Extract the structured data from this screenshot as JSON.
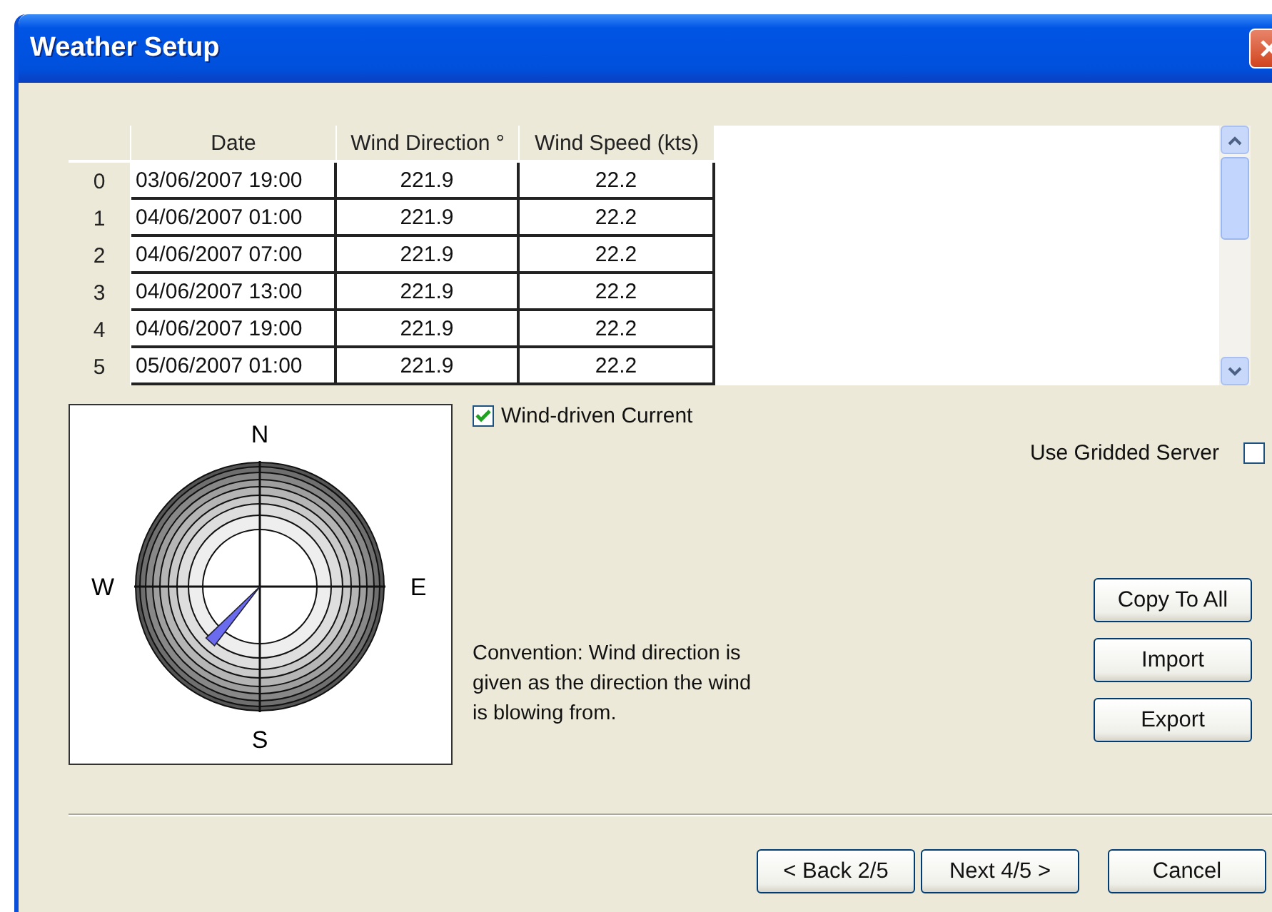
{
  "window": {
    "title": "Weather Setup"
  },
  "table": {
    "columns": [
      "Date",
      "Wind Direction °",
      "Wind Speed (kts)"
    ],
    "rows": [
      {
        "index": "0",
        "date": "03/06/2007 19:00",
        "wind_direction": "221.9",
        "wind_speed": "22.2"
      },
      {
        "index": "1",
        "date": "04/06/2007 01:00",
        "wind_direction": "221.9",
        "wind_speed": "22.2"
      },
      {
        "index": "2",
        "date": "04/06/2007 07:00",
        "wind_direction": "221.9",
        "wind_speed": "22.2"
      },
      {
        "index": "3",
        "date": "04/06/2007 13:00",
        "wind_direction": "221.9",
        "wind_speed": "22.2"
      },
      {
        "index": "4",
        "date": "04/06/2007 19:00",
        "wind_direction": "221.9",
        "wind_speed": "22.2"
      },
      {
        "index": "5",
        "date": "05/06/2007 01:00",
        "wind_direction": "221.9",
        "wind_speed": "22.2"
      }
    ]
  },
  "compass": {
    "north": "N",
    "south": "S",
    "west": "W",
    "east": "E"
  },
  "wind_driven_current": {
    "label": "Wind-driven Current",
    "checked": true
  },
  "use_gridded_server": {
    "label": "Use Gridded Server",
    "checked": false
  },
  "convention": "Convention: Wind direction is given as the direction the wind is blowing from.",
  "side_buttons": [
    "Copy To All",
    "Import",
    "Export"
  ],
  "footer_buttons": [
    "< Back 2/5",
    "Next 4/5 >",
    "Cancel"
  ]
}
